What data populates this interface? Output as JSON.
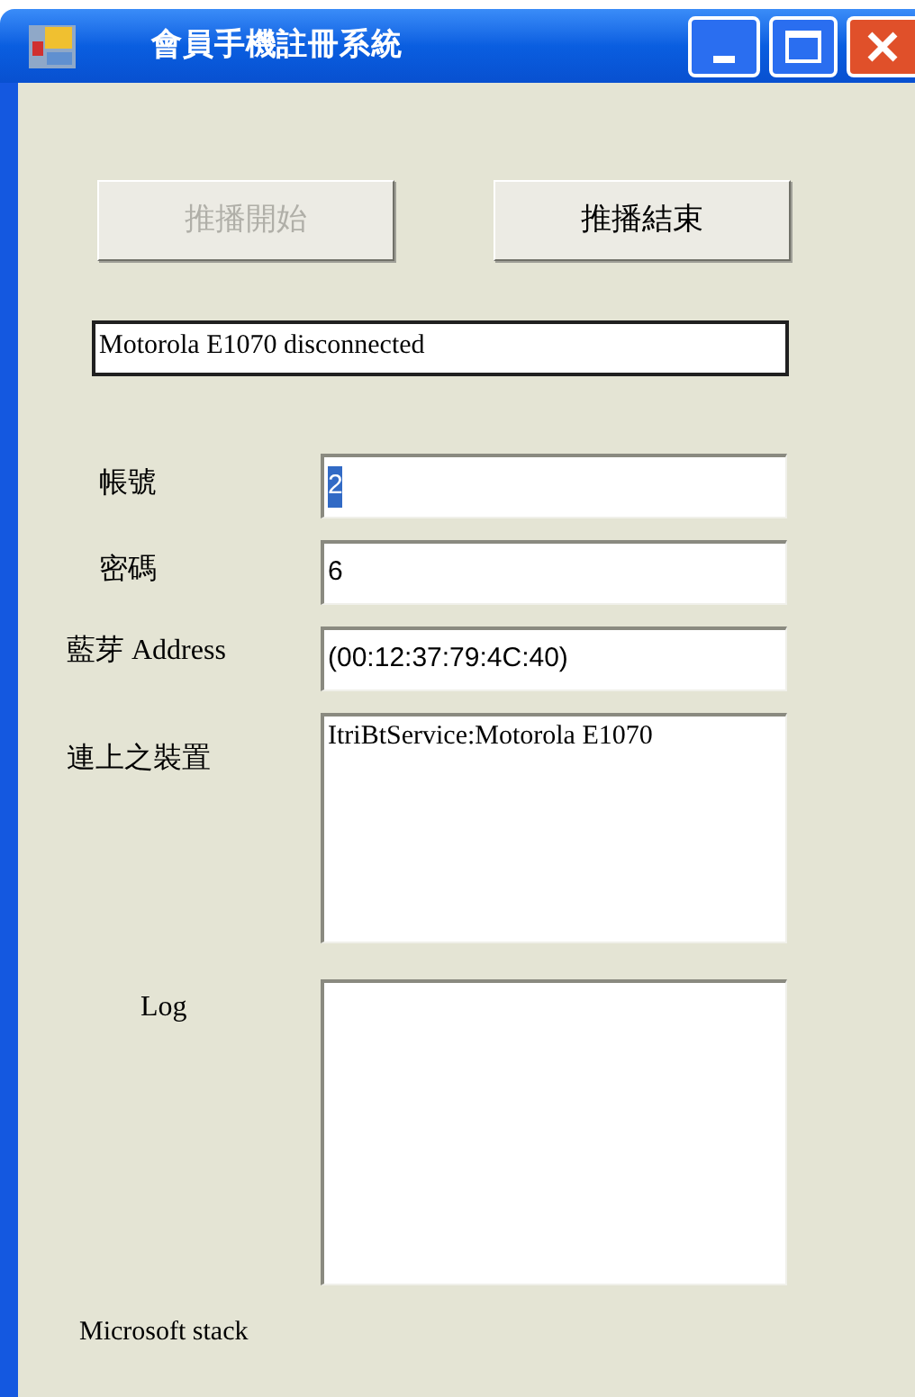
{
  "window": {
    "title": "會員手機註冊系統"
  },
  "buttons": [
    {
      "label": "推播開始",
      "disabled": true
    },
    {
      "label": "推播結束",
      "disabled": false
    }
  ],
  "status": "Motorola E1070 disconnected",
  "fields": [
    {
      "label": "帳號",
      "value": "2",
      "highlighted": true
    },
    {
      "label": "密碼",
      "value": "6",
      "highlighted": false
    },
    {
      "label": "藍芽 Address",
      "value": "(00:12:37:79:4C:40)",
      "highlighted": false
    }
  ],
  "devices": {
    "label": "連上之裝置",
    "items": [
      "ItriBtService:Motorola E1070"
    ]
  },
  "log": {
    "label": "Log"
  },
  "footer": "Microsoft stack"
}
